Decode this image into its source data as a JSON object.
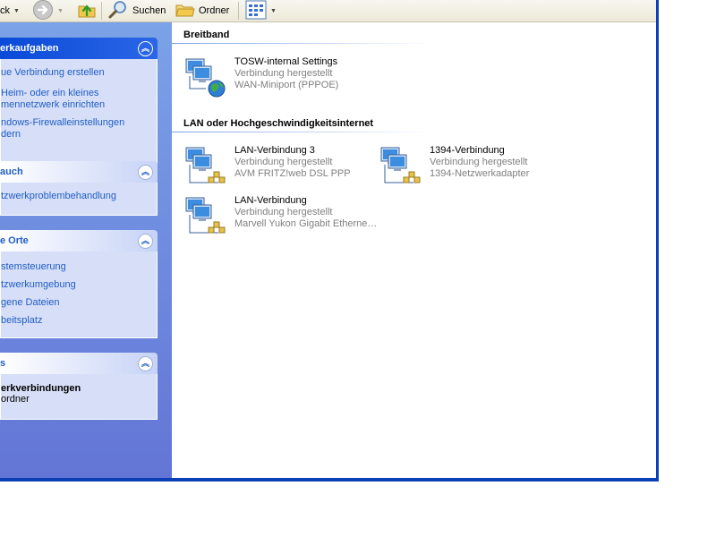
{
  "toolbar": {
    "back_label": "ck",
    "search_label": "Suchen",
    "folders_label": "Ordner"
  },
  "taskpane": {
    "network_tasks": {
      "title": "erkaufgaben",
      "links": [
        "ue Verbindung erstellen",
        "Heim- oder ein kleines",
        "mennetzwerk einrichten",
        "ndows-Firewalleinstellungen",
        "dern"
      ]
    },
    "see_also": {
      "title": "auch",
      "links": [
        "tzwerkproblembehandlung"
      ]
    },
    "other_places": {
      "title": "e Orte",
      "links": [
        "stemsteuerung",
        "tzwerkumgebung",
        "gene Dateien",
        "beitsplatz"
      ]
    },
    "details": {
      "title": "s",
      "heading": "erkverbindungen",
      "subtext": "ordner"
    }
  },
  "content": {
    "groups": [
      {
        "title": "Breitband",
        "items": [
          {
            "name": "TOSW-internal Settings",
            "status": "Verbindung hergestellt",
            "device": "WAN-Miniport (PPPOE)",
            "icon": "broadband-connection-icon"
          }
        ]
      },
      {
        "title": "LAN oder Hochgeschwindigkeitsinternet",
        "items": [
          {
            "name": "LAN-Verbindung 3",
            "status": "Verbindung hergestellt",
            "device": "AVM FRITZ!web DSL PPP",
            "icon": "lan-connection-icon"
          },
          {
            "name": "1394-Verbindung",
            "status": "Verbindung hergestellt",
            "device": "1394-Netzwerkadapter",
            "icon": "lan-connection-icon"
          },
          {
            "name": "LAN-Verbindung",
            "status": "Verbindung hergestellt",
            "device": "Marvell Yukon Gigabit Etherne…",
            "icon": "lan-connection-icon"
          }
        ]
      }
    ]
  },
  "colors": {
    "taskpane_top": "#7ba2e7",
    "taskpane_bottom": "#6375d6",
    "link": "#215dc6",
    "frame": "#0a3fb5"
  }
}
